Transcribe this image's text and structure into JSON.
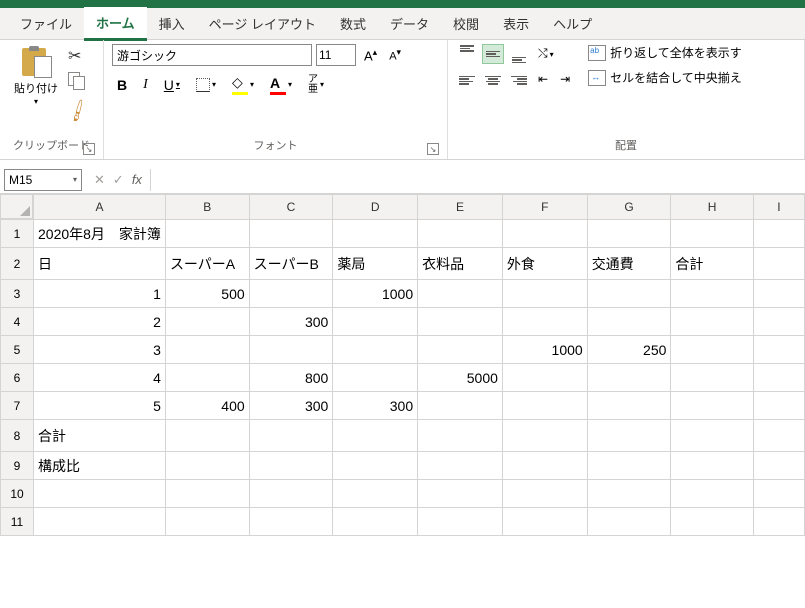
{
  "tabs": {
    "file": "ファイル",
    "home": "ホーム",
    "insert": "挿入",
    "pageLayout": "ページ レイアウト",
    "formulas": "数式",
    "data": "データ",
    "review": "校閲",
    "view": "表示",
    "help": "ヘルプ"
  },
  "ribbon": {
    "clipboard": {
      "paste": "貼り付け",
      "groupLabel": "クリップボード"
    },
    "font": {
      "name": "游ゴシック",
      "size": "11",
      "groupLabel": "フォント",
      "bold": "B",
      "italic": "I",
      "underline": "U",
      "furiganaTop": "ア",
      "furiganaBottom": "亜",
      "fontColorA": "A",
      "growA": "A",
      "shrinkA": "A"
    },
    "alignment": {
      "groupLabel": "配置",
      "wrap": "折り返して全体を表示す",
      "wrapAb": "ab",
      "merge": "セルを結合して中央揃え"
    }
  },
  "nameBox": "M15",
  "formula": "",
  "columns": [
    "A",
    "B",
    "C",
    "D",
    "E",
    "F",
    "G",
    "H",
    "I"
  ],
  "rows": [
    "1",
    "2",
    "3",
    "4",
    "5",
    "6",
    "7",
    "8",
    "9",
    "10",
    "11"
  ],
  "cells": {
    "A1": "2020年8月　家計簿",
    "A2": "日",
    "B2": "スーパーA",
    "C2": "スーパーB",
    "D2": "薬局",
    "E2": "衣料品",
    "F2": "外食",
    "G2": "交通費",
    "H2": "合計",
    "A3": "1",
    "B3": "500",
    "D3": "1000",
    "A4": "2",
    "C4": "300",
    "A5": "3",
    "F5": "1000",
    "G5": "250",
    "A6": "4",
    "C6": "800",
    "E6": "5000",
    "A7": "5",
    "B7": "400",
    "C7": "300",
    "D7": "300",
    "A8": "合計",
    "A9": "構成比"
  }
}
